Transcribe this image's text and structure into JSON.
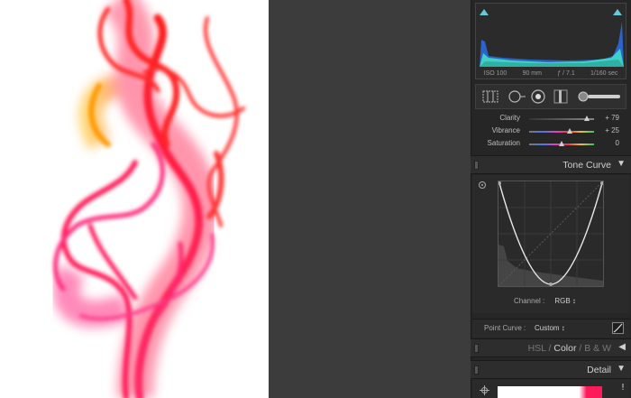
{
  "histogram": {
    "iso": "ISO 100",
    "focal_length": "90 mm",
    "aperture": "ƒ / 7.1",
    "shutter": "1/160 sec"
  },
  "tools": {
    "icons": [
      "crop-overlay-icon",
      "spot-removal-icon",
      "red-eye-icon",
      "graduated-filter-icon",
      "adjustment-brush-icon"
    ]
  },
  "presence": {
    "sliders": [
      {
        "label": "Clarity",
        "value": "+ 79",
        "level": 0.895
      },
      {
        "label": "Vibrance",
        "value": "+ 25",
        "level": 0.625
      },
      {
        "label": "Saturation",
        "value": "0",
        "level": 0.5
      }
    ]
  },
  "tone_curve": {
    "title": "Tone Curve",
    "channel_label": "Channel :",
    "channel_value": "RGB ↕",
    "point_curve_label": "Point Curve :",
    "point_curve_value": "Custom ↕"
  },
  "hsl_panel": {
    "hsl": "HSL",
    "sep1": "/",
    "color": "Color",
    "sep2": "/",
    "bw": "B & W"
  },
  "detail_panel": {
    "title": "Detail"
  },
  "colors": {
    "histogram_cyan": "#3fd0c8",
    "histogram_blue": "#2c63c9",
    "panel_bg": "#262626",
    "smoke_red": "#ff1a3c",
    "smoke_orange": "#ff8a00"
  }
}
